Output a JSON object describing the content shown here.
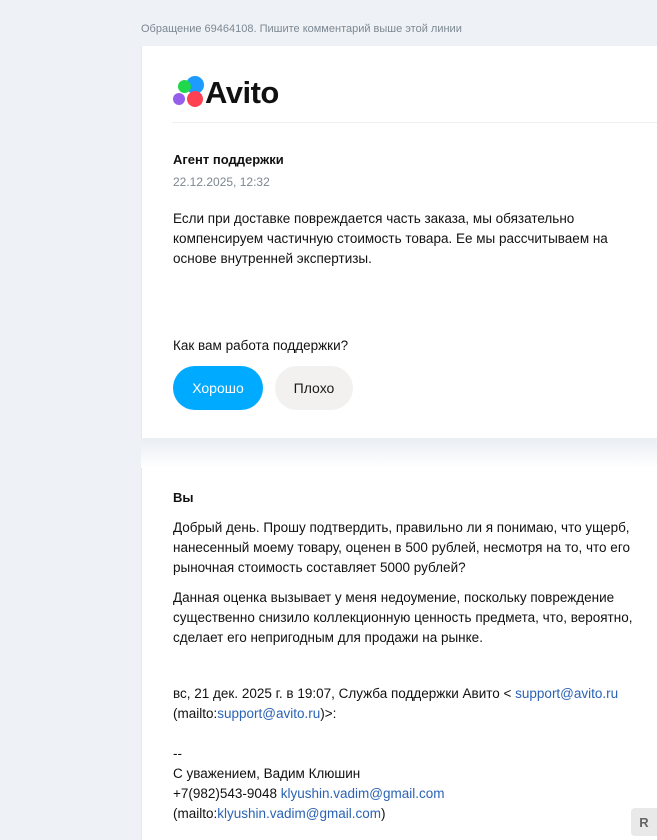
{
  "top_line": "Обращение 69464108. Пишите комментарий выше этой линии",
  "logo": {
    "text": "Avito"
  },
  "agent_message": {
    "sender": "Агент поддержки",
    "date": "22.12.2025, 12:32",
    "text": "Если при доставке повреждается часть заказа, мы обязательно компенсируем частичную стоимость товара. Ее мы рассчитываем на основе внутренней экспертизы."
  },
  "rating": {
    "question": "Как вам работа поддержки?",
    "good_label": "Хорошо",
    "bad_label": "Плохо"
  },
  "reply": {
    "sender": "Вы",
    "paragraph1": "Добрый день. Прошу подтвердить, правильно ли я понимаю, что ущерб, нанесенный моему товару, оценен в 500 рублей, несмотря на то, что его рыночная стоимость составляет 5000 рублей?",
    "paragraph2": "Данная оценка вызывает у меня недоумение, поскольку повреждение существенно снизило коллекционную ценность предмета, что, вероятно, сделает его непригодным для продажи на рынке.",
    "quote_prefix": "вс, 21 дек. 2025 г. в 19:07, Служба поддержки Авито < ",
    "quote_email": "support@avito.ru",
    "quote_mailto_prefix": "(mailto:",
    "quote_mailto_email": "support@avito.ru",
    "quote_mailto_suffix": ")>:",
    "sig_dashes": "--",
    "sig_regards": "С уважением, Вадим Клюшин",
    "sig_phone": "+7(982)543-9048 ",
    "sig_email": "klyushin.vadim@gmail.com",
    "sig_mailto_prefix": " (mailto:",
    "sig_mailto_email": "klyushin.vadim@gmail.com",
    "sig_mailto_suffix": ")"
  },
  "corner_badge": "R"
}
